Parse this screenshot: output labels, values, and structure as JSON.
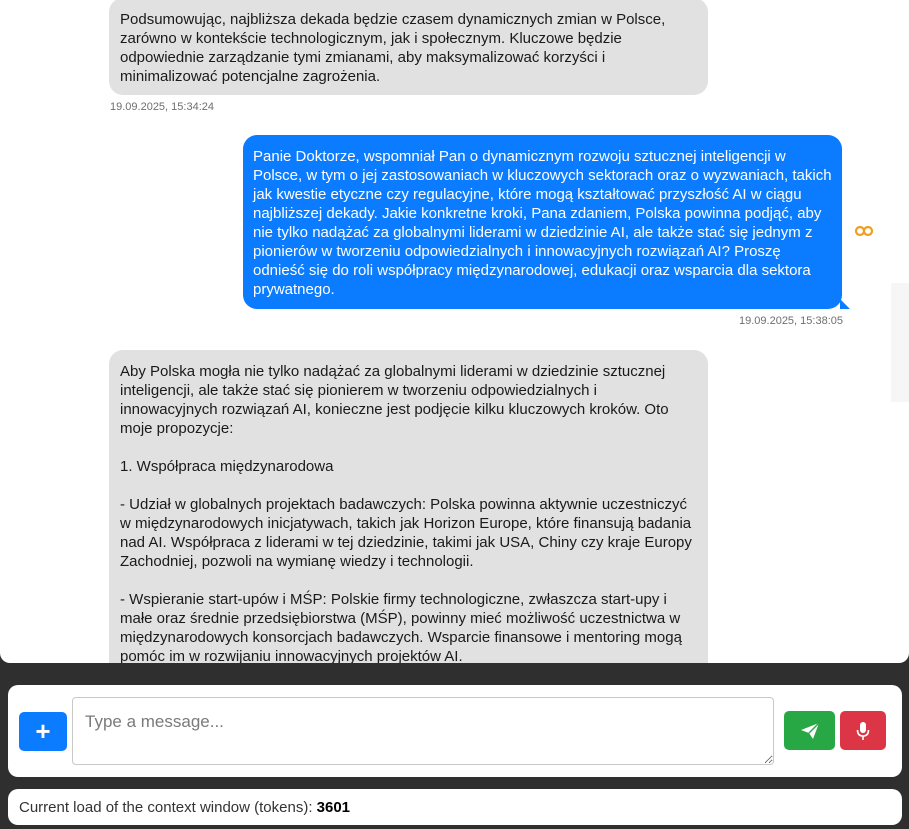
{
  "messages": [
    {
      "role": "assistant",
      "text": "Podsumowując, najbliższa dekada będzie czasem dynamicznych zmian w Polsce, zarówno w kontekście technologicznym, jak i społecznym. Kluczowe będzie odpowiednie zarządzanie tymi zmianami, aby maksymalizować korzyści i minimalizować potencjalne zagrożenia.",
      "timestamp": "19.09.2025, 15:34:24"
    },
    {
      "role": "user",
      "text": "Panie Doktorze, wspomniał Pan o dynamicznym rozwoju sztucznej inteligencji w Polsce, w tym o jej zastosowaniach w kluczowych sektorach oraz o wyzwaniach, takich jak kwestie etyczne czy regulacyjne, które mogą kształtować przyszłość AI w ciągu najbliższej dekady. Jakie konkretne kroki, Pana zdaniem, Polska powinna podjąć, aby nie tylko nadążać za globalnymi liderami w dziedzinie AI, ale także stać się jednym z pionierów w tworzeniu odpowiedzialnych i innowacyjnych rozwiązań AI? Proszę odnieść się do roli współpracy międzynarodowej, edukacji oraz wsparcia dla sektora prywatnego.",
      "timestamp": "19.09.2025, 15:38:05"
    },
    {
      "role": "assistant",
      "paragraphs": [
        "Aby Polska mogła nie tylko nadążać za globalnymi liderami w dziedzinie sztucznej inteligencji, ale także stać się pionierem w tworzeniu odpowiedzialnych i innowacyjnych rozwiązań AI, konieczne jest podjęcie kilku kluczowych kroków. Oto moje propozycje:",
        "1. Współpraca międzynarodowa",
        "- Udział w globalnych projektach badawczych: Polska powinna aktywnie uczestniczyć w międzynarodowych inicjatywach, takich jak Horizon Europe, które finansują badania nad AI. Współpraca z liderami w tej dziedzinie, takimi jak USA, Chiny czy kraje Europy Zachodniej, pozwoli na wymianę wiedzy i technologii.",
        "- Wspieranie start-upów i MŚP: Polskie firmy technologiczne, zwłaszcza start-upy i małe oraz średnie przedsiębiorstwa (MŚP), powinny mieć możliwość uczestnictwa w międzynarodowych konsorcjach badawczych. Wsparcie finansowe i mentoring mogą pomóc im w rozwijaniu innowacyjnych projektów AI."
      ]
    }
  ],
  "icons": {
    "loop": "infinity-loop-icon",
    "add": "plus-icon",
    "send": "paper-plane-icon",
    "mic": "microphone-icon"
  },
  "composer": {
    "add_label": "+",
    "placeholder": "Type a message..."
  },
  "status": {
    "label": "Current load of the context window (tokens): ",
    "value": "3601"
  },
  "colors": {
    "user_bubble": "#0b7cff",
    "assistant_bubble": "#e1e1e1",
    "send_button": "#28a745",
    "mic_button": "#dc3545",
    "loop_icon": "#f0a020"
  }
}
